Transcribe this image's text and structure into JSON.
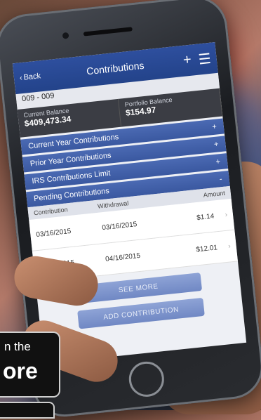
{
  "app": {
    "nav": {
      "back": "Back",
      "title": "Contributions",
      "plus": "+",
      "menu": "☰"
    },
    "account": "009 - 009",
    "balances": {
      "current_label": "Current Balance",
      "current_value": "$409,473.34",
      "portfolio_label": "Portfolio Balance",
      "portfolio_value": "$154.97"
    },
    "sections": [
      {
        "label": "Current Year Contributions",
        "icon": "+"
      },
      {
        "label": "Prior Year Contributions",
        "icon": "+"
      },
      {
        "label": "IRS Contributions Limit",
        "icon": "+"
      },
      {
        "label": "Pending Contributions",
        "icon": "-"
      }
    ],
    "table": {
      "headers": [
        "Contribution",
        "Withdrawal",
        "Amount"
      ],
      "rows": [
        {
          "contribution": "03/16/2015",
          "withdrawal": "03/16/2015",
          "amount": "$1.14"
        },
        {
          "contribution": "04/16/2015",
          "withdrawal": "04/16/2015",
          "amount": "$12.01"
        }
      ]
    },
    "see_more": "SEE MORE",
    "add_contribution": "ADD CONTRIBUTION"
  },
  "store_badge": {
    "top": "n the",
    "main": "ore"
  }
}
